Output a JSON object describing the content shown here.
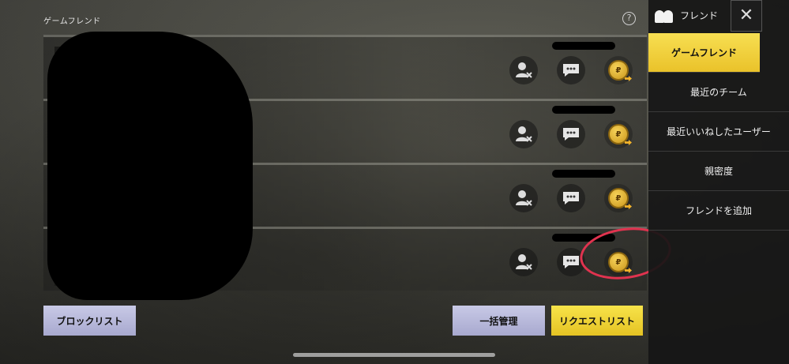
{
  "header": {
    "section_title": "ゲームフレンド",
    "help_icon": "?"
  },
  "friend_rows": [
    {
      "actions": [
        "remove-friend-icon",
        "chat-icon",
        "gift-coin-icon"
      ]
    },
    {
      "actions": [
        "remove-friend-icon",
        "chat-icon",
        "gift-coin-icon"
      ]
    },
    {
      "actions": [
        "remove-friend-icon",
        "chat-icon",
        "gift-coin-icon"
      ]
    },
    {
      "actions": [
        "remove-friend-icon",
        "chat-icon",
        "gift-coin-icon"
      ]
    }
  ],
  "buttons": {
    "block_list": "ブロックリスト",
    "bulk_manage": "一括管理",
    "request_list": "リクエストリスト"
  },
  "sidebar": {
    "title": "フレンド",
    "close": "✕",
    "items": [
      {
        "label": "ゲームフレンド",
        "active": true
      },
      {
        "label": "最近のチーム",
        "active": false
      },
      {
        "label": "最近いいねしたユーザー",
        "active": false
      },
      {
        "label": "親密度",
        "active": false
      },
      {
        "label": "フレンドを追加",
        "active": false
      }
    ]
  },
  "colors": {
    "accent_yellow": "#eac22a",
    "button_lavender": "#b8b9da",
    "annotation_red": "#e0334f"
  }
}
